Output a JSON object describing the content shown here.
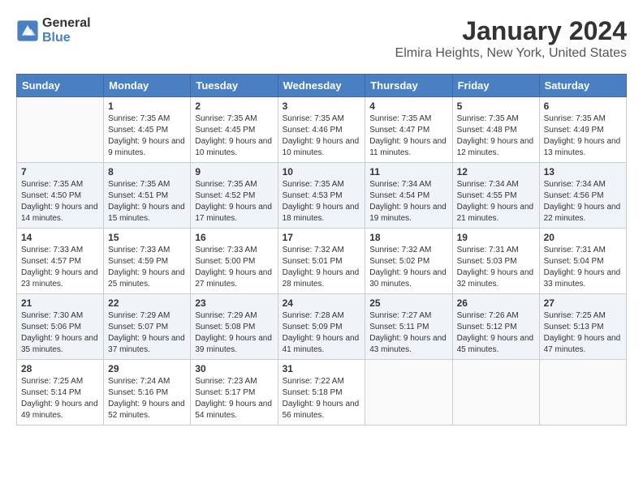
{
  "logo": {
    "line1": "General",
    "line2": "Blue"
  },
  "title": "January 2024",
  "location": "Elmira Heights, New York, United States",
  "days_of_week": [
    "Sunday",
    "Monday",
    "Tuesday",
    "Wednesday",
    "Thursday",
    "Friday",
    "Saturday"
  ],
  "weeks": [
    [
      {
        "day": "",
        "sunrise": "",
        "sunset": "",
        "daylight": ""
      },
      {
        "day": "1",
        "sunrise": "Sunrise: 7:35 AM",
        "sunset": "Sunset: 4:45 PM",
        "daylight": "Daylight: 9 hours and 9 minutes."
      },
      {
        "day": "2",
        "sunrise": "Sunrise: 7:35 AM",
        "sunset": "Sunset: 4:45 PM",
        "daylight": "Daylight: 9 hours and 10 minutes."
      },
      {
        "day": "3",
        "sunrise": "Sunrise: 7:35 AM",
        "sunset": "Sunset: 4:46 PM",
        "daylight": "Daylight: 9 hours and 10 minutes."
      },
      {
        "day": "4",
        "sunrise": "Sunrise: 7:35 AM",
        "sunset": "Sunset: 4:47 PM",
        "daylight": "Daylight: 9 hours and 11 minutes."
      },
      {
        "day": "5",
        "sunrise": "Sunrise: 7:35 AM",
        "sunset": "Sunset: 4:48 PM",
        "daylight": "Daylight: 9 hours and 12 minutes."
      },
      {
        "day": "6",
        "sunrise": "Sunrise: 7:35 AM",
        "sunset": "Sunset: 4:49 PM",
        "daylight": "Daylight: 9 hours and 13 minutes."
      }
    ],
    [
      {
        "day": "7",
        "sunrise": "Sunrise: 7:35 AM",
        "sunset": "Sunset: 4:50 PM",
        "daylight": "Daylight: 9 hours and 14 minutes."
      },
      {
        "day": "8",
        "sunrise": "Sunrise: 7:35 AM",
        "sunset": "Sunset: 4:51 PM",
        "daylight": "Daylight: 9 hours and 15 minutes."
      },
      {
        "day": "9",
        "sunrise": "Sunrise: 7:35 AM",
        "sunset": "Sunset: 4:52 PM",
        "daylight": "Daylight: 9 hours and 17 minutes."
      },
      {
        "day": "10",
        "sunrise": "Sunrise: 7:35 AM",
        "sunset": "Sunset: 4:53 PM",
        "daylight": "Daylight: 9 hours and 18 minutes."
      },
      {
        "day": "11",
        "sunrise": "Sunrise: 7:34 AM",
        "sunset": "Sunset: 4:54 PM",
        "daylight": "Daylight: 9 hours and 19 minutes."
      },
      {
        "day": "12",
        "sunrise": "Sunrise: 7:34 AM",
        "sunset": "Sunset: 4:55 PM",
        "daylight": "Daylight: 9 hours and 21 minutes."
      },
      {
        "day": "13",
        "sunrise": "Sunrise: 7:34 AM",
        "sunset": "Sunset: 4:56 PM",
        "daylight": "Daylight: 9 hours and 22 minutes."
      }
    ],
    [
      {
        "day": "14",
        "sunrise": "Sunrise: 7:33 AM",
        "sunset": "Sunset: 4:57 PM",
        "daylight": "Daylight: 9 hours and 23 minutes."
      },
      {
        "day": "15",
        "sunrise": "Sunrise: 7:33 AM",
        "sunset": "Sunset: 4:59 PM",
        "daylight": "Daylight: 9 hours and 25 minutes."
      },
      {
        "day": "16",
        "sunrise": "Sunrise: 7:33 AM",
        "sunset": "Sunset: 5:00 PM",
        "daylight": "Daylight: 9 hours and 27 minutes."
      },
      {
        "day": "17",
        "sunrise": "Sunrise: 7:32 AM",
        "sunset": "Sunset: 5:01 PM",
        "daylight": "Daylight: 9 hours and 28 minutes."
      },
      {
        "day": "18",
        "sunrise": "Sunrise: 7:32 AM",
        "sunset": "Sunset: 5:02 PM",
        "daylight": "Daylight: 9 hours and 30 minutes."
      },
      {
        "day": "19",
        "sunrise": "Sunrise: 7:31 AM",
        "sunset": "Sunset: 5:03 PM",
        "daylight": "Daylight: 9 hours and 32 minutes."
      },
      {
        "day": "20",
        "sunrise": "Sunrise: 7:31 AM",
        "sunset": "Sunset: 5:04 PM",
        "daylight": "Daylight: 9 hours and 33 minutes."
      }
    ],
    [
      {
        "day": "21",
        "sunrise": "Sunrise: 7:30 AM",
        "sunset": "Sunset: 5:06 PM",
        "daylight": "Daylight: 9 hours and 35 minutes."
      },
      {
        "day": "22",
        "sunrise": "Sunrise: 7:29 AM",
        "sunset": "Sunset: 5:07 PM",
        "daylight": "Daylight: 9 hours and 37 minutes."
      },
      {
        "day": "23",
        "sunrise": "Sunrise: 7:29 AM",
        "sunset": "Sunset: 5:08 PM",
        "daylight": "Daylight: 9 hours and 39 minutes."
      },
      {
        "day": "24",
        "sunrise": "Sunrise: 7:28 AM",
        "sunset": "Sunset: 5:09 PM",
        "daylight": "Daylight: 9 hours and 41 minutes."
      },
      {
        "day": "25",
        "sunrise": "Sunrise: 7:27 AM",
        "sunset": "Sunset: 5:11 PM",
        "daylight": "Daylight: 9 hours and 43 minutes."
      },
      {
        "day": "26",
        "sunrise": "Sunrise: 7:26 AM",
        "sunset": "Sunset: 5:12 PM",
        "daylight": "Daylight: 9 hours and 45 minutes."
      },
      {
        "day": "27",
        "sunrise": "Sunrise: 7:25 AM",
        "sunset": "Sunset: 5:13 PM",
        "daylight": "Daylight: 9 hours and 47 minutes."
      }
    ],
    [
      {
        "day": "28",
        "sunrise": "Sunrise: 7:25 AM",
        "sunset": "Sunset: 5:14 PM",
        "daylight": "Daylight: 9 hours and 49 minutes."
      },
      {
        "day": "29",
        "sunrise": "Sunrise: 7:24 AM",
        "sunset": "Sunset: 5:16 PM",
        "daylight": "Daylight: 9 hours and 52 minutes."
      },
      {
        "day": "30",
        "sunrise": "Sunrise: 7:23 AM",
        "sunset": "Sunset: 5:17 PM",
        "daylight": "Daylight: 9 hours and 54 minutes."
      },
      {
        "day": "31",
        "sunrise": "Sunrise: 7:22 AM",
        "sunset": "Sunset: 5:18 PM",
        "daylight": "Daylight: 9 hours and 56 minutes."
      },
      {
        "day": "",
        "sunrise": "",
        "sunset": "",
        "daylight": ""
      },
      {
        "day": "",
        "sunrise": "",
        "sunset": "",
        "daylight": ""
      },
      {
        "day": "",
        "sunrise": "",
        "sunset": "",
        "daylight": ""
      }
    ]
  ]
}
